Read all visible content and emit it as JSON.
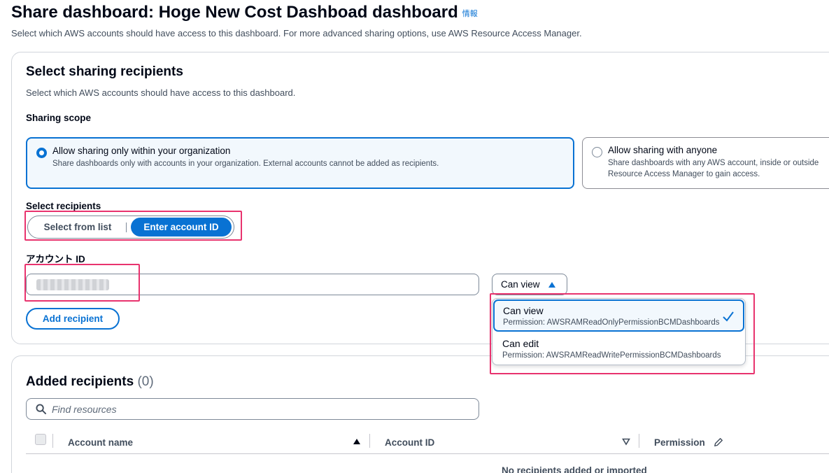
{
  "header": {
    "title": "Share dashboard: Hoge New Cost Dashboad dashboard",
    "info_link": "情報",
    "description": "Select which AWS accounts should have access to this dashboard. For more advanced sharing options, use AWS Resource Access Manager."
  },
  "recipients_section": {
    "title": "Select sharing recipients",
    "description": "Select which AWS accounts should have access to this dashboard.",
    "scope_label": "Sharing scope",
    "scope_options": [
      {
        "label": "Allow sharing only within your organization",
        "description": "Share dashboards only with accounts in your organization. External accounts cannot be added as recipients.",
        "selected": true
      },
      {
        "label": "Allow sharing with anyone",
        "description_line1": "Share dashboards with any AWS account, inside or outside",
        "description_line2": "Resource Access Manager to gain access.",
        "selected": false
      }
    ],
    "select_recipients_label": "Select recipients",
    "mode_options": [
      "Select from list",
      "Enter account ID"
    ],
    "mode_selected": "Enter account ID",
    "account_id_label": "アカウント ID",
    "account_id_value": "",
    "permission_select": {
      "value": "Can view",
      "expanded": true
    },
    "add_button": "Add recipient",
    "permission_options": [
      {
        "label": "Can view",
        "description": "Permission: AWSRAMReadOnlyPermissionBCMDashboards",
        "selected": true
      },
      {
        "label": "Can edit",
        "description": "Permission: AWSRAMReadWritePermissionBCMDashboards",
        "selected": false
      }
    ]
  },
  "added_section": {
    "title": "Added recipients",
    "count": "(0)",
    "search_placeholder": "Find resources",
    "columns": [
      "Account name",
      "Account ID",
      "Permission"
    ],
    "empty_message": "No recipients added or imported"
  },
  "colors": {
    "accent": "#0972d3",
    "highlight": "#e8336e",
    "text": "#000716",
    "muted": "#414d5c"
  },
  "icons": [
    "info-link",
    "radio-icon",
    "caret-up-icon",
    "check-icon",
    "search-icon",
    "sort-asc-icon",
    "sort-desc-icon",
    "edit-pencil-icon"
  ]
}
